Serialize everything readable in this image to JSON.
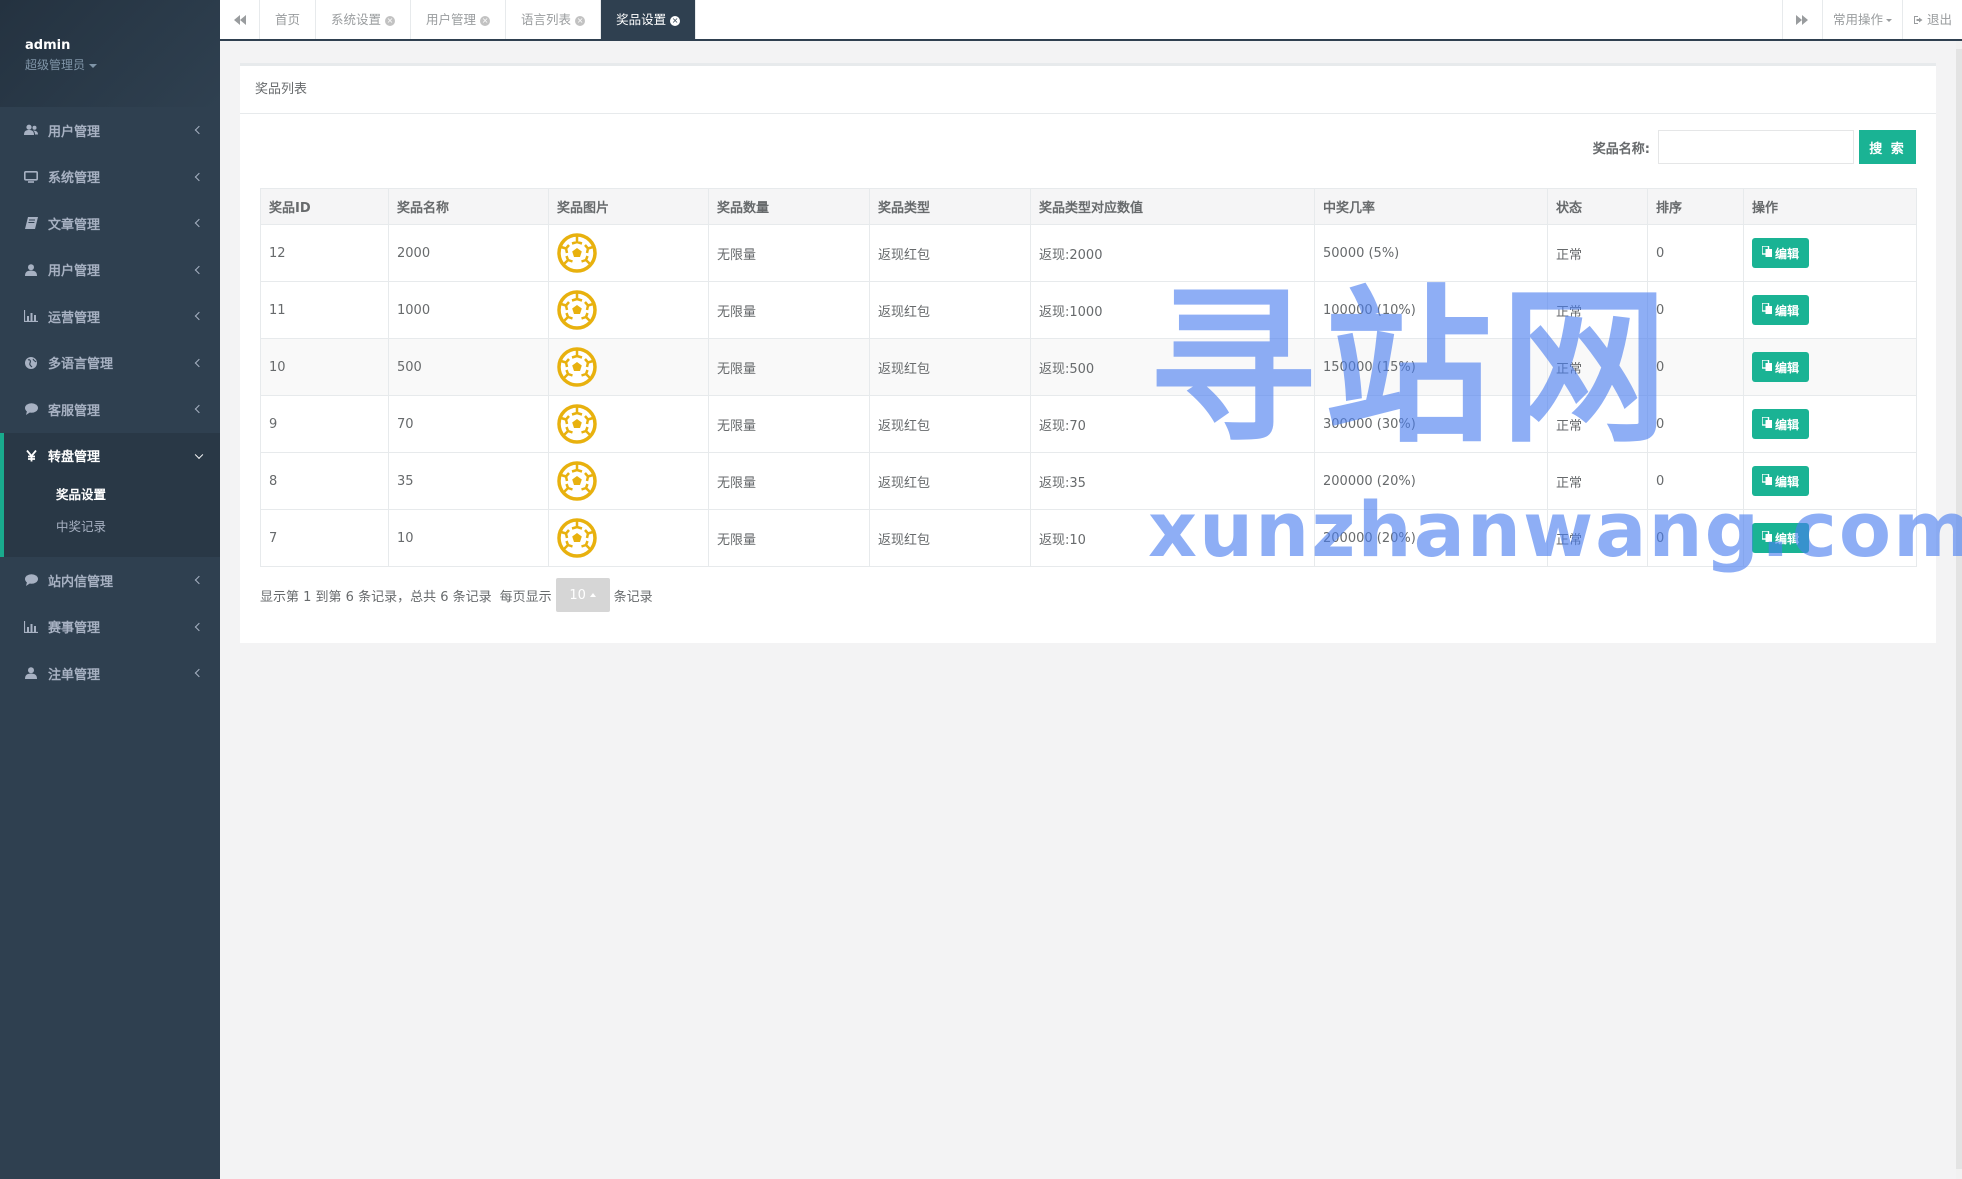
{
  "profile": {
    "username": "admin",
    "role": "超级管理员"
  },
  "sidebar": {
    "items": [
      {
        "label": "用户管理",
        "icon": "users-icon"
      },
      {
        "label": "系统管理",
        "icon": "desktop-icon"
      },
      {
        "label": "文章管理",
        "icon": "book-icon"
      },
      {
        "label": "用户管理",
        "icon": "user-icon"
      },
      {
        "label": "运营管理",
        "icon": "bar-chart-icon"
      },
      {
        "label": "多语言管理",
        "icon": "globe-icon"
      },
      {
        "label": "客服管理",
        "icon": "comment-icon"
      }
    ],
    "active": {
      "label": "转盘管理",
      "icon": "yen-icon",
      "children": [
        {
          "label": "奖品设置",
          "current": true
        },
        {
          "label": "中奖记录",
          "current": false
        }
      ]
    },
    "items_after": [
      {
        "label": "站内信管理",
        "icon": "comment-icon"
      },
      {
        "label": "赛事管理",
        "icon": "bar-chart-icon"
      },
      {
        "label": "注单管理",
        "icon": "user-icon"
      }
    ]
  },
  "topbar": {
    "tabs": [
      {
        "label": "首页",
        "closable": false,
        "active": false
      },
      {
        "label": "系统设置",
        "closable": true,
        "active": false
      },
      {
        "label": "用户管理",
        "closable": true,
        "active": false
      },
      {
        "label": "语言列表",
        "closable": true,
        "active": false
      },
      {
        "label": "奖品设置",
        "closable": true,
        "active": true
      }
    ],
    "common_ops": "常用操作",
    "logout": "退出"
  },
  "panel": {
    "title": "奖品列表",
    "search_label": "奖品名称:",
    "search_value": "",
    "search_button": "搜 索"
  },
  "table": {
    "headers": [
      "奖品ID",
      "奖品名称",
      "奖品图片",
      "奖品数量",
      "奖品类型",
      "奖品类型对应数值",
      "中奖几率",
      "状态",
      "排序",
      "操作"
    ],
    "edit_label": "编辑",
    "rows": [
      {
        "id": "12",
        "name": "2000",
        "qty": "无限量",
        "type": "返现红包",
        "value": "返现:2000",
        "rate": "50000 (5%)",
        "status": "正常",
        "sort": "0"
      },
      {
        "id": "11",
        "name": "1000",
        "qty": "无限量",
        "type": "返现红包",
        "value": "返现:1000",
        "rate": "100000 (10%)",
        "status": "正常",
        "sort": "0"
      },
      {
        "id": "10",
        "name": "500",
        "qty": "无限量",
        "type": "返现红包",
        "value": "返现:500",
        "rate": "150000 (15%)",
        "status": "正常",
        "sort": "0"
      },
      {
        "id": "9",
        "name": "70",
        "qty": "无限量",
        "type": "返现红包",
        "value": "返现:70",
        "rate": "300000 (30%)",
        "status": "正常",
        "sort": "0"
      },
      {
        "id": "8",
        "name": "35",
        "qty": "无限量",
        "type": "返现红包",
        "value": "返现:35",
        "rate": "200000 (20%)",
        "status": "正常",
        "sort": "0"
      },
      {
        "id": "7",
        "name": "10",
        "qty": "无限量",
        "type": "返现红包",
        "value": "返现:10",
        "rate": "200000 (20%)",
        "status": "正常",
        "sort": "0"
      }
    ]
  },
  "pagination": {
    "summary": "显示第 1 到第 6 条记录，总共 6 条记录",
    "per_page_prefix": "每页显示",
    "per_page": "10",
    "per_page_suffix": "条记录"
  },
  "watermark": {
    "cn": "寻站网",
    "en": "xunzhanwang.com"
  },
  "colors": {
    "sidebar": "#2f4050",
    "accent": "#1ab394",
    "ball": "#e8b10e",
    "watermark": "#4a7ef0"
  }
}
